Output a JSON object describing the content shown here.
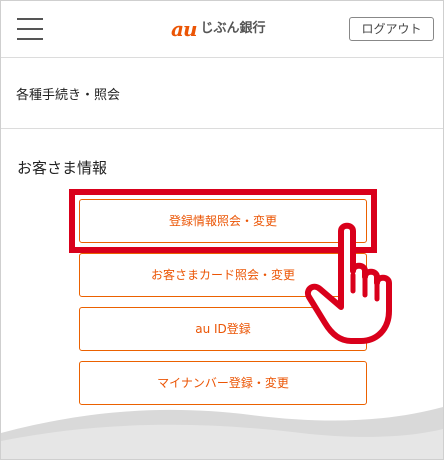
{
  "header": {
    "logo_au": "au",
    "logo_bank": "じぶん銀行",
    "logout_label": "ログアウト"
  },
  "procedures": {
    "title": "各種手続き・照会"
  },
  "customer_info": {
    "title": "お客さま情報",
    "buttons": [
      {
        "label": "登録情報照会・変更"
      },
      {
        "label": "お客さまカード照会・変更"
      },
      {
        "label": "au ID登録"
      },
      {
        "label": "マイナンバー登録・変更"
      }
    ]
  },
  "colors": {
    "brand_orange": "#eb5505",
    "highlight_red": "#d9001b"
  }
}
